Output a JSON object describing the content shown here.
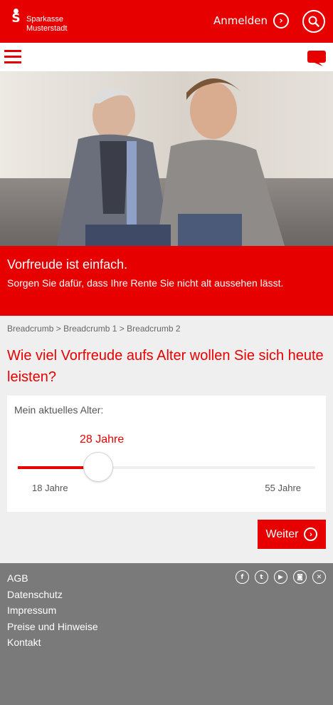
{
  "header": {
    "logo_line1": "Sparkasse",
    "logo_line2": "Musterstadt",
    "login_label": "Anmelden",
    "login_arrow": "›",
    "accent_color": "#e60000"
  },
  "hero": {
    "headline": "Vorfreude ist einfach.",
    "subline": "Sorgen Sie dafür, dass Ihre Rente Sie nicht alt aussehen lässt."
  },
  "breadcrumb": {
    "items": [
      "Breadcrumb",
      "Breadcrumb 1",
      "Breadcrumb 2"
    ],
    "separator": ">"
  },
  "question": "Wie viel Vorfreude aufs Alter wollen Sie sich heute leisten?",
  "age_slider": {
    "label": "Mein aktuelles Alter:",
    "value_label": "28 Jahre",
    "value": 28,
    "min": 18,
    "max": 55,
    "min_label": "18 Jahre",
    "max_label": "55 Jahre"
  },
  "next_button": {
    "label": "Weiter",
    "arrow": "›"
  },
  "footer": {
    "links": [
      "AGB",
      "Datenschutz",
      "Impressum",
      "Preise und Hinweise",
      "Kontakt"
    ],
    "social_icons": [
      "facebook-icon",
      "twitter-icon",
      "youtube-icon",
      "instagram-icon",
      "xing-icon"
    ]
  }
}
